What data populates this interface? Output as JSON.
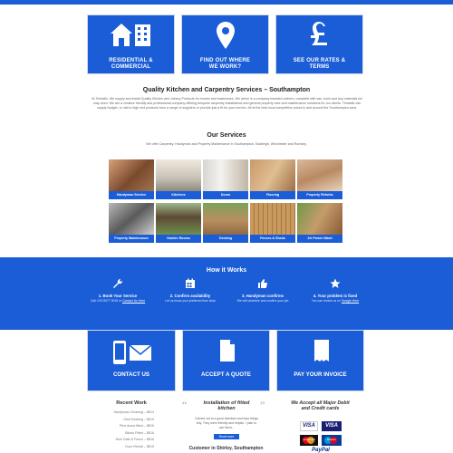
{
  "colors": {
    "brand": "#1a5dd6",
    "card_border": "#cfd8ea"
  },
  "cards": [
    {
      "label_1": "RESIDENTIAL &",
      "label_2": "COMMERCIAL",
      "icon": "house-building-icon"
    },
    {
      "label_1": "FIND OUT WHERE",
      "label_2": "WE WORK?",
      "icon": "location-pin-icon"
    },
    {
      "label_1": "SEE OUR RATES &",
      "label_2": "TERMS",
      "icon": "pound-sign-icon"
    }
  ],
  "intro": {
    "title": "Quality Kitchen and Carpentry Services – Southampton",
    "text": "At Timbafix, We supply and install Quality Kitchen and Joinery Products for homes and businesses. We arrive in a company branded uniform, complete with van, tools and any materials we may need. We are a creative friendly and professional company offering bespoke carpentry installations and general property care and maintenance solutions for our clients. Timbafix can supply budget, or mid to high end products from a range of suppliers or provide just a fit for your service. All at the best local competitive prices in and around the Southampton area."
  },
  "services": {
    "title": "Our Services",
    "subtitle": "We offer Carpentry, Handyman and Property Maintenance in Southampton, Eastleigh, Winchester and Romsey.",
    "items": [
      "Handyman Service",
      "Kitchens",
      "Doors",
      "Flooring",
      "Property Refurbs",
      "Property Maintenance",
      "Garden Rooms",
      "Decking",
      "Fences & Sheds",
      "Jet Power Wash"
    ]
  },
  "how": {
    "title": "How it Works",
    "steps": [
      {
        "title": "1. Book Your Service",
        "desc_1": "Call: 023 8077 0015 or",
        "desc_link": "Contact Us Here",
        "icon": "wrench-icon"
      },
      {
        "title": "2. Confirm availability",
        "desc_1": "Let us know your preferred time slots",
        "desc_link": "",
        "icon": "calendar-icon"
      },
      {
        "title": "3. Handyman confirms",
        "desc_1": "We will schedule and confirm your job",
        "desc_link": "",
        "icon": "thumbs-up-icon"
      },
      {
        "title": "4. Your problem is fixed",
        "desc_1": "You can review us on",
        "desc_link": "Google Here",
        "icon": "star-icon"
      }
    ]
  },
  "bottom": [
    {
      "label": "CONTACT US",
      "icon": "phone-mail-icon"
    },
    {
      "label": "ACCEPT A QUOTE",
      "icon": "document-icon"
    },
    {
      "label": "PAY YOUR INVOICE",
      "icon": "invoice-icon"
    }
  ],
  "recent": {
    "title": "Recent Work",
    "items": [
      "Handyman Cleaning – $€14",
      "Oled Decking – $€19",
      "Pine doors fitted – $€16",
      "Blinds Fitted – $€16",
      "New Gate & Fence – $€15",
      "Door Refurb – $€15"
    ]
  },
  "testimonial": {
    "title_1": "Installation of fitted",
    "title_2": "kitchen",
    "quote": "Carried out to a good standard and kept things tidy. They were friendly and helpful. I plan to use them...",
    "read_more": "Read more",
    "footer": "Customer in Shirley, Southampton"
  },
  "payments": {
    "title_1": "We Accept all Major Debit",
    "title_2": "and Credit cards",
    "cards": [
      "VISA",
      "VISA",
      "mastercard",
      "Maestro",
      "PayPal"
    ]
  }
}
